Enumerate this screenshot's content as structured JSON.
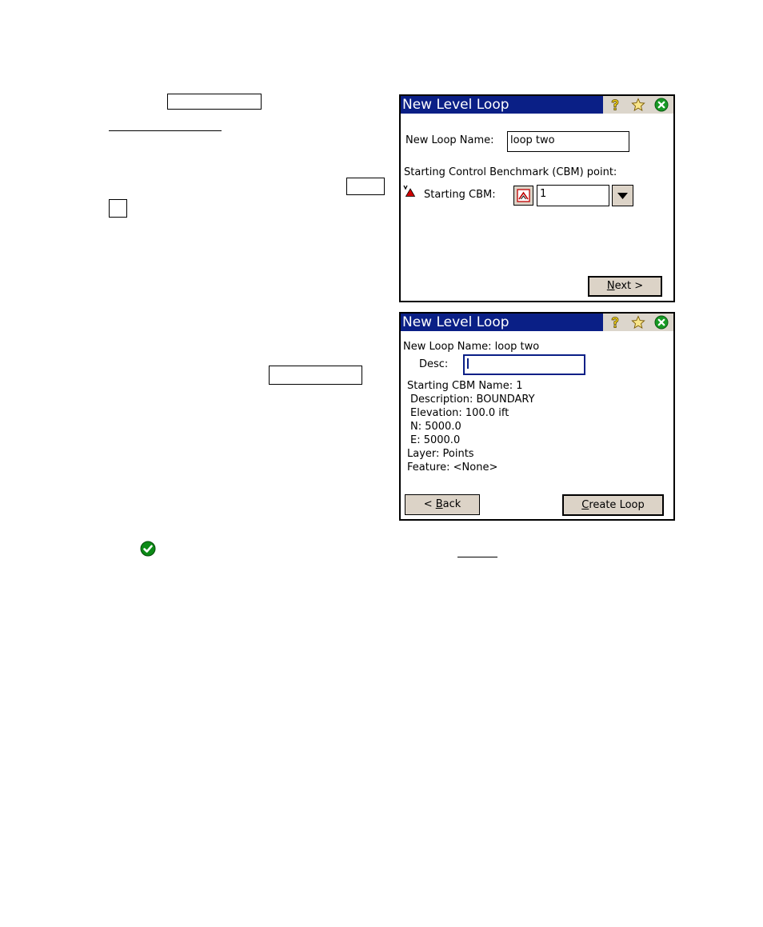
{
  "dialog_one": {
    "title": "New Level Loop",
    "loop_name_label": "New Loop Name:",
    "loop_name_value": "loop two",
    "section_label": "Starting Control Benchmark (CBM) point:",
    "cbm_label": "Starting CBM:",
    "cbm_value": "1",
    "next_mnemonic": "N",
    "next_rest": "ext >"
  },
  "dialog_two": {
    "title": "New Level Loop",
    "loop_name_line": "New Loop Name: loop two",
    "desc_label": "Desc:",
    "desc_value": "",
    "details": [
      "Starting CBM Name: 1",
      "Description: BOUNDARY",
      "Elevation: 100.0 ift",
      "N: 5000.0",
      "E: 5000.0",
      "Layer: Points",
      "Feature: <None>"
    ],
    "back_prefix": "< ",
    "back_mnemonic": "B",
    "back_rest": "ack",
    "create_mnemonic": "C",
    "create_rest": "reate Loop"
  },
  "colors": {
    "titlebar": "#0a1f86",
    "button_face": "#dcd3c7",
    "ok_green": "#0c8a16"
  },
  "icons": {
    "help": "question-mark-icon",
    "favorite": "star-icon",
    "close": "close-icon",
    "ok": "checkmark-icon",
    "benchmark": "benchmark-triangle-icon",
    "map_pick": "map-pick-icon",
    "dropdown": "dropdown-arrow-icon"
  }
}
